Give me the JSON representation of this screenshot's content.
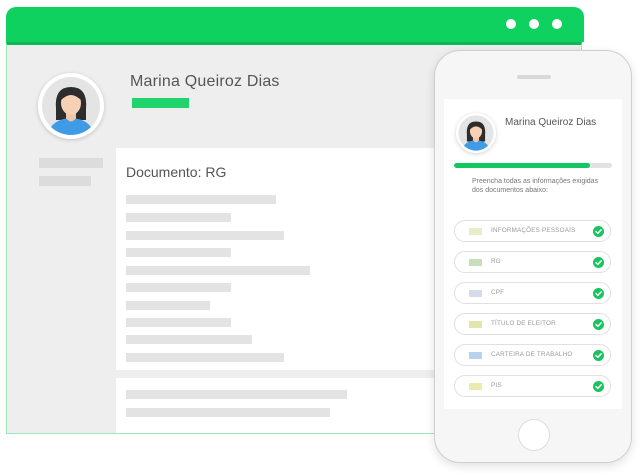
{
  "colors": {
    "brand_green": "#0fd15f",
    "progress_green": "#12c75f",
    "check_green": "#19c35f"
  },
  "desktop": {
    "window_controls": [
      "dot",
      "dot",
      "dot"
    ],
    "profile": {
      "name": "Marina Queiroz Dias",
      "avatar_icon": "user-avatar-icon"
    },
    "document": {
      "title": "Documento: RG"
    }
  },
  "mobile": {
    "profile": {
      "name": "Marina Queiroz Dias",
      "avatar_icon": "user-avatar-icon"
    },
    "progress": 0.86,
    "instructions": "Preencha todas as informações exigidas dos documentos abaixo:",
    "documents": [
      {
        "label": "INFORMAÇÕES PESSOAIS",
        "color": "#e9ecc8",
        "status_icon": "check-icon"
      },
      {
        "label": "RG",
        "color": "#c7dfb9",
        "status_icon": "check-icon"
      },
      {
        "label": "CPF",
        "color": "#d5dbea",
        "status_icon": "check-icon"
      },
      {
        "label": "TÍTULO DE ELEITOR",
        "color": "#e3e6ac",
        "status_icon": "check-icon"
      },
      {
        "label": "CARTEIRA DE TRABALHO",
        "color": "#b8d2ed",
        "status_icon": "check-icon"
      },
      {
        "label": "PIS",
        "color": "#ecebaf",
        "status_icon": "check-icon"
      }
    ]
  }
}
